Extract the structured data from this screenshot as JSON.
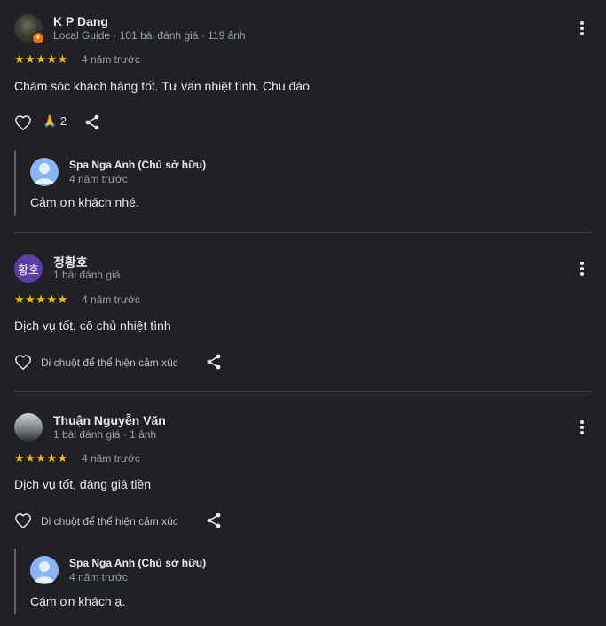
{
  "reviews": [
    {
      "name": "K P Dang",
      "meta": "Local Guide · 101 bài đánh giá · 119 ảnh",
      "stars": "★★★★★",
      "rating": 5,
      "time": "4 năm trước",
      "text": "Chăm sóc khách hàng tốt. Tư vấn nhiệt tình. Chu đáo",
      "reaction_emoji": "🙏",
      "reaction_count": "2",
      "owner_reply": {
        "name": "Spa Nga Anh (Chủ sở hữu)",
        "time": "4 năm trước",
        "text": "Cảm ơn khách nhé."
      }
    },
    {
      "avatar_text": "황호",
      "name": "정황호",
      "meta": "1 bài đánh giá",
      "stars": "★★★★★",
      "rating": 5,
      "time": "4 năm trước",
      "text": "Dịch vụ tốt, cô chủ nhiệt tình",
      "react_hint": "Di chuột để thể hiện cảm xúc"
    },
    {
      "name": "Thuận Nguyễn Văn",
      "meta": "1 bài đánh giá · 1 ảnh",
      "stars": "★★★★★",
      "rating": 5,
      "time": "4 năm trước",
      "text": "Dịch vụ tốt, đáng giá tiền",
      "react_hint": "Di chuột để thể hiện cảm xúc",
      "owner_reply": {
        "name": "Spa Nga Anh (Chủ sở hữu)",
        "time": "4 năm trước",
        "text": "Cám ơn khách ạ."
      }
    }
  ],
  "colors": {
    "background": "#202124",
    "star": "#fbbc04",
    "owner_avatar": "#8ab4f8",
    "secondary_text": "#9aa0a6"
  }
}
